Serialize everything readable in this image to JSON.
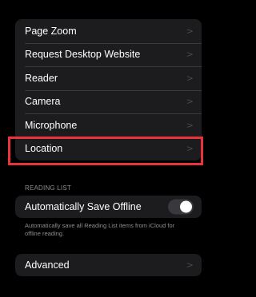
{
  "settings_group": {
    "items": [
      {
        "label": "Page Zoom"
      },
      {
        "label": "Request Desktop Website"
      },
      {
        "label": "Reader"
      },
      {
        "label": "Camera"
      },
      {
        "label": "Microphone"
      },
      {
        "label": "Location"
      }
    ]
  },
  "reading_list": {
    "header": "READING LIST",
    "toggle_label": "Automatically Save Offline",
    "toggle_on": false,
    "footer": "Automatically save all Reading List items from iCloud for offline reading."
  },
  "advanced": {
    "label": "Advanced"
  },
  "chevron_glyph": ">",
  "colors": {
    "highlight": "#e8333a",
    "group_bg": "#1c1c1e",
    "secondary_text": "#8e8e93"
  }
}
